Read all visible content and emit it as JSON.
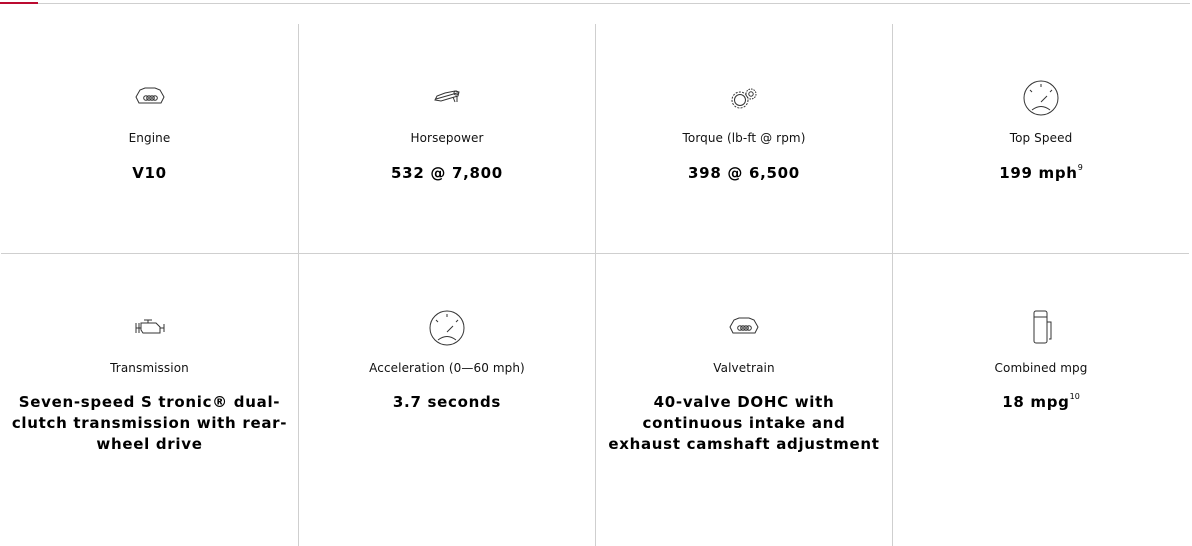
{
  "specs": [
    {
      "label": "Engine",
      "value": "V10",
      "sup": "",
      "icon": "engine-block-icon"
    },
    {
      "label": "Horsepower",
      "value": "532 @ 7,800",
      "sup": "",
      "icon": "horsepower-icon"
    },
    {
      "label": "Torque (lb-ft @ rpm)",
      "value": "398 @ 6,500",
      "sup": "",
      "icon": "gears-icon"
    },
    {
      "label": "Top Speed",
      "value": "199 mph",
      "sup": "9",
      "icon": "speedometer-icon"
    },
    {
      "label": "Transmission",
      "value": "Seven-speed S tronic® dual-clutch transmission with rear-wheel drive",
      "sup": "",
      "icon": "transmission-icon"
    },
    {
      "label": "Acceleration (0—60 mph)",
      "value": "3.7 seconds",
      "sup": "",
      "icon": "speedometer-icon"
    },
    {
      "label": "Valvetrain",
      "value": "40-valve DOHC with continuous intake and exhaust camshaft adjustment",
      "sup": "",
      "icon": "engine-block-icon"
    },
    {
      "label": "Combined mpg",
      "value": "18 mpg",
      "sup": "10",
      "icon": "fuel-pump-icon"
    }
  ],
  "colors": {
    "accent": "#bb0a30",
    "divider": "#cfcfcf",
    "text": "#000000"
  }
}
